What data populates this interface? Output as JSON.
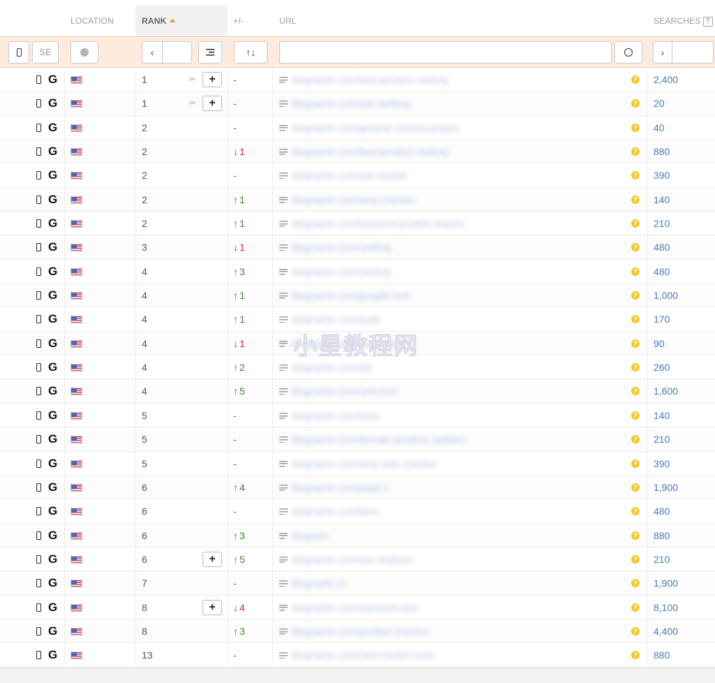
{
  "header": {
    "location": "LOCATION",
    "rank": "RANK",
    "change": "+/-",
    "url": "URL",
    "searches": "SEARCHES",
    "help": "?"
  },
  "filters": {
    "engine_placeholder": "SE",
    "prev_symbol": "‹",
    "next_symbol": "›",
    "change_sort_symbol": "🡡🡣",
    "circle_symbol": "○"
  },
  "rows": [
    {
      "rank": "1",
      "change": "-",
      "dir": "none",
      "searches": "2,400",
      "url": "blogname.com/best-product-ranking",
      "add": true,
      "scissor": true
    },
    {
      "rank": "1",
      "change": "-",
      "dir": "none",
      "searches": "20",
      "url": "blogname.com/seo-ranking",
      "add": true,
      "scissor": true
    },
    {
      "rank": "2",
      "change": "-",
      "dir": "none",
      "searches": "40",
      "url": "blogname.com/general-content-project",
      "add": false
    },
    {
      "rank": "2",
      "change": "1",
      "dir": "down",
      "searches": "880",
      "url": "blogname.com/best-product-ranking",
      "add": false
    },
    {
      "rank": "2",
      "change": "-",
      "dir": "none",
      "searches": "390",
      "url": "blogname.com/seo-tracker",
      "add": false
    },
    {
      "rank": "2",
      "change": "1",
      "dir": "up",
      "searches": "140",
      "url": "blogname.com/serp-checker",
      "add": false
    },
    {
      "rank": "2",
      "change": "1",
      "dir": "up",
      "searches": "210",
      "url": "blogname.com/keyword-position-tracker",
      "add": false
    },
    {
      "rank": "3",
      "change": "1",
      "dir": "down",
      "searches": "480",
      "url": "blogname.com/ranking",
      "add": false
    },
    {
      "rank": "4",
      "change": "3",
      "dir": "up",
      "searches": "480",
      "url": "blogname.com/ranking",
      "add": false
    },
    {
      "rank": "4",
      "change": "1",
      "dir": "up",
      "searches": "1,000",
      "url": "blogname.com/google-rank",
      "add": false
    },
    {
      "rank": "4",
      "change": "1",
      "dir": "up",
      "searches": "170",
      "url": "blogname.com/audit",
      "add": false
    },
    {
      "rank": "4",
      "change": "1",
      "dir": "down",
      "searches": "90",
      "url": "blogname.com/page-report",
      "add": false
    },
    {
      "rank": "4",
      "change": "2",
      "dir": "up",
      "searches": "260",
      "url": "blogname.com/api",
      "add": false
    },
    {
      "rank": "4",
      "change": "5",
      "dir": "up",
      "searches": "1,600",
      "url": "blogname.com/rank-tool",
      "add": false
    },
    {
      "rank": "5",
      "change": "-",
      "dir": "none",
      "searches": "140",
      "url": "blogname.com/tools",
      "add": false
    },
    {
      "rank": "5",
      "change": "-",
      "dir": "none",
      "searches": "210",
      "url": "blogname.com/domain-position-updates",
      "add": false
    },
    {
      "rank": "5",
      "change": "-",
      "dir": "none",
      "searches": "390",
      "url": "blogname.com/serp-rank-checker",
      "add": false
    },
    {
      "rank": "6",
      "change": "4",
      "dir": "up",
      "searches": "1,900",
      "url": "blogname.com/page-1",
      "add": false
    },
    {
      "rank": "6",
      "change": "-",
      "dir": "none",
      "searches": "480",
      "url": "blogname.com/docs",
      "add": false
    },
    {
      "rank": "6",
      "change": "3",
      "dir": "up",
      "searches": "880",
      "url": "blog/seo",
      "add": false
    },
    {
      "rank": "6",
      "change": "5",
      "dir": "up",
      "searches": "210",
      "url": "blogname.com/seo-analysis",
      "add": true
    },
    {
      "rank": "7",
      "change": "-",
      "dir": "none",
      "searches": "1,900",
      "url": "blog/rank-10",
      "add": false
    },
    {
      "rank": "8",
      "change": "4",
      "dir": "down",
      "searches": "8,100",
      "url": "blogname.com/keyword-rank",
      "add": true
    },
    {
      "rank": "8",
      "change": "3",
      "dir": "up",
      "searches": "4,400",
      "url": "blogname.com/position-checker",
      "add": false
    },
    {
      "rank": "13",
      "change": "-",
      "dir": "none",
      "searches": "880",
      "url": "blogname.com/rank-tracker-tools",
      "add": false
    }
  ],
  "watermark": "小星教程网",
  "colors": {
    "up": "#2f8b22",
    "down": "#d42b2b",
    "accent": "#f0941e",
    "filterbar": "#fdecde",
    "link": "#4a7ab5"
  }
}
